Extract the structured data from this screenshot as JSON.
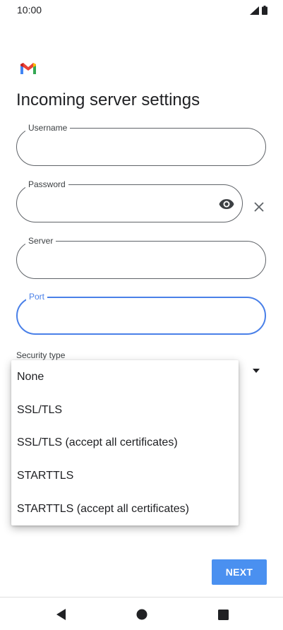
{
  "status_bar": {
    "time": "10:00",
    "icons": [
      "signal-icon",
      "battery-icon"
    ]
  },
  "app": {
    "logo": "gmail-logo"
  },
  "page": {
    "title": "Incoming server settings"
  },
  "fields": {
    "username": {
      "label": "Username",
      "value": ""
    },
    "password": {
      "label": "Password",
      "value": ""
    },
    "server": {
      "label": "Server",
      "value": ""
    },
    "port": {
      "label": "Port",
      "value": ""
    }
  },
  "security": {
    "label": "Security type",
    "options": [
      "None",
      "SSL/TLS",
      "SSL/TLS (accept all certificates)",
      "STARTTLS",
      "STARTTLS (accept all certificates)"
    ]
  },
  "actions": {
    "next_label": "NEXT"
  },
  "colors": {
    "accent": "#4a80e8",
    "button": "#4a90f0",
    "text": "#202124"
  },
  "nav": {
    "icons": [
      "back-icon",
      "home-icon",
      "recents-icon"
    ]
  }
}
